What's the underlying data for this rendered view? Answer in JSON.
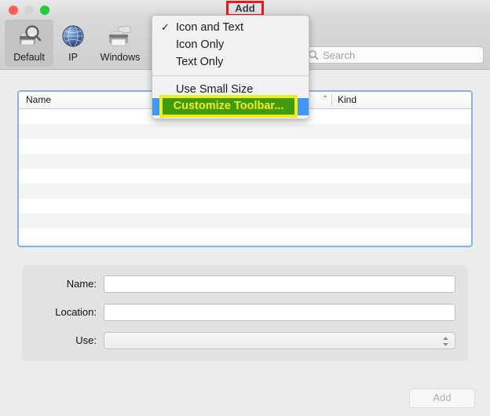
{
  "window": {
    "title": "Add",
    "traffic_lights": [
      {
        "name": "close",
        "color": "#ff5f57"
      },
      {
        "name": "minimize",
        "color": "#d4d4d4"
      },
      {
        "name": "zoom",
        "color": "#28c940"
      }
    ],
    "title_annotation_color": "#e8191a"
  },
  "toolbar": {
    "items": [
      {
        "label": "Default",
        "icon": "printer-magnifier-icon",
        "selected": true
      },
      {
        "label": "IP",
        "icon": "globe-icon",
        "selected": false
      },
      {
        "label": "Windows",
        "icon": "printer-fax-icon",
        "selected": false
      }
    ],
    "search": {
      "placeholder": "Search",
      "value": "",
      "label": "Search",
      "icon": "search-icon"
    }
  },
  "context_menu": {
    "items": [
      {
        "label": "Icon and Text",
        "checked": true,
        "highlight": false,
        "separator_before": false
      },
      {
        "label": "Icon Only",
        "checked": false,
        "highlight": false,
        "separator_before": false
      },
      {
        "label": "Text Only",
        "checked": false,
        "highlight": false,
        "separator_before": false
      },
      {
        "label": "Use Small Size",
        "checked": false,
        "highlight": false,
        "separator_before": true
      },
      {
        "label": "Customize Toolbar...",
        "checked": false,
        "highlight": true,
        "separator_before": false
      }
    ],
    "checkmark_glyph": "✓",
    "annotation": {
      "label": "Customize Toolbar...",
      "fill_color": "#3f9c10",
      "border_color": "#f3ec18",
      "text_color": "#f3ec18"
    },
    "highlight_color": "#3f97f6"
  },
  "list": {
    "columns": [
      {
        "key": "name",
        "label": "Name",
        "sort_indicator": "⌃"
      },
      {
        "key": "kind",
        "label": "Kind",
        "sort_indicator": ""
      }
    ],
    "rows": [],
    "empty_row_count": 10,
    "focus_ring_color": "#86b4e8"
  },
  "form": {
    "fields": [
      {
        "label": "Name:",
        "type": "text",
        "value": "",
        "placeholder": ""
      },
      {
        "label": "Location:",
        "type": "text",
        "value": "",
        "placeholder": ""
      },
      {
        "label": "Use:",
        "type": "popup",
        "value": "",
        "placeholder": ""
      }
    ]
  },
  "footer": {
    "add_button": {
      "label": "Add",
      "enabled": false
    }
  }
}
